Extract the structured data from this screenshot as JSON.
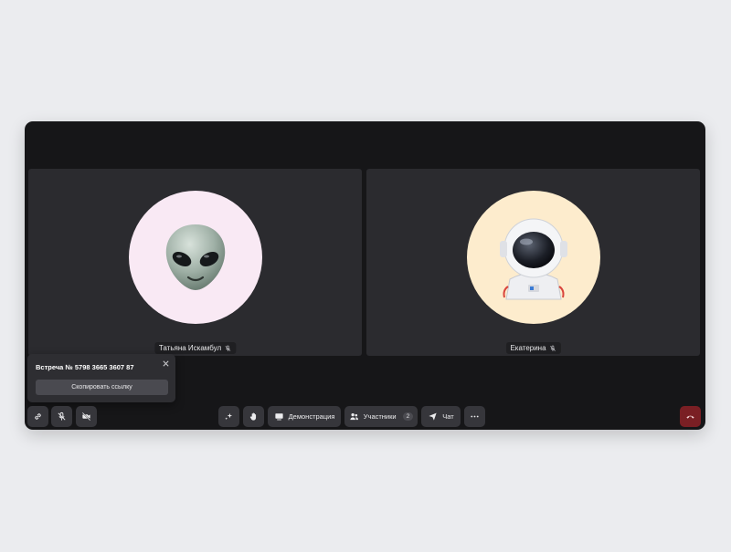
{
  "participants": [
    {
      "name": "Татьяна Искамбул",
      "avatar_emoji": "👽",
      "avatar_bg": "#f9e9f4",
      "mic": "muted"
    },
    {
      "name": "Екатерина",
      "avatar_emoji": "🧑‍🚀",
      "avatar_bg": "#fdeccd",
      "mic": "muted"
    }
  ],
  "meeting_popover": {
    "title": "Встреча № 5798 3665 3607 87",
    "close_icon": "close-icon",
    "copy_link_label": "Скопировать ссылку"
  },
  "toolbar": {
    "left": [
      "link-icon",
      "mic-off-icon",
      "camera-off-icon"
    ],
    "center": {
      "effects_icon": "sparkles-icon",
      "raise_hand_icon": "hand-icon",
      "screen_share_label": "Демонстрация",
      "participants_label": "Участники",
      "participants_count": "2",
      "chat_label": "Чат",
      "more_icon": "more-icon"
    },
    "hangup_icon": "phone-hangup-icon"
  },
  "colors": {
    "page_bg": "#ebecef",
    "window_bg": "#161618",
    "tile_bg": "#2b2b2f",
    "button_bg": "#36363b",
    "hangup_bg": "#7a1f24"
  }
}
